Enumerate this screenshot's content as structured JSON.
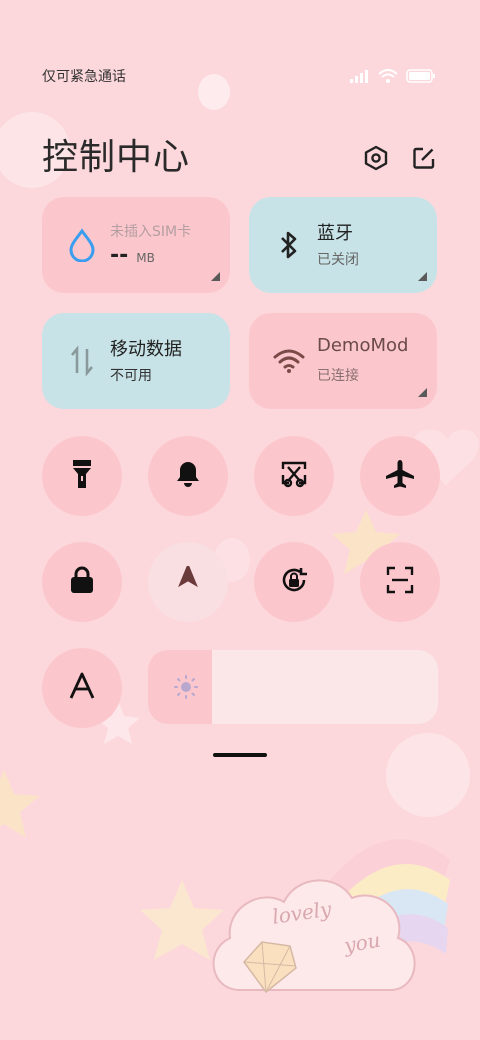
{
  "status": {
    "carrier_text": "仅可紧急通话",
    "icons": [
      "signal-icon",
      "wifi-icon",
      "battery-icon"
    ]
  },
  "header": {
    "title": "控制中心",
    "icons": [
      "settings-icon",
      "edit-icon"
    ]
  },
  "tiles": [
    {
      "name": "data-usage",
      "icon": "water-drop-icon",
      "line1": "未插入SIM卡",
      "value": "--",
      "unit": "MB",
      "color": "#fbc7cc"
    },
    {
      "name": "bluetooth",
      "icon": "bluetooth-icon",
      "line1": "蓝牙",
      "line2": "已关闭",
      "color": "#c8e3e7"
    },
    {
      "name": "mobile-data",
      "icon": "data-arrows-icon",
      "line1": "移动数据",
      "line2": "不可用",
      "color": "#c8e3e7"
    },
    {
      "name": "wifi",
      "icon": "wifi-icon",
      "line1": "DemoMod",
      "line2": "已连接",
      "color": "#fbc7cc"
    }
  ],
  "toggles": [
    "flashlight-icon",
    "bell-icon",
    "screenshot-icon",
    "airplane-icon",
    "lock-icon",
    "location-arrow-icon",
    "rotation-lock-icon",
    "scan-icon",
    "font-size-icon"
  ],
  "brightness": {
    "icon": "brightness-icon",
    "level": 0.22
  },
  "decoration": {
    "sticker_text_1": "lovely",
    "sticker_text_2": "you"
  }
}
